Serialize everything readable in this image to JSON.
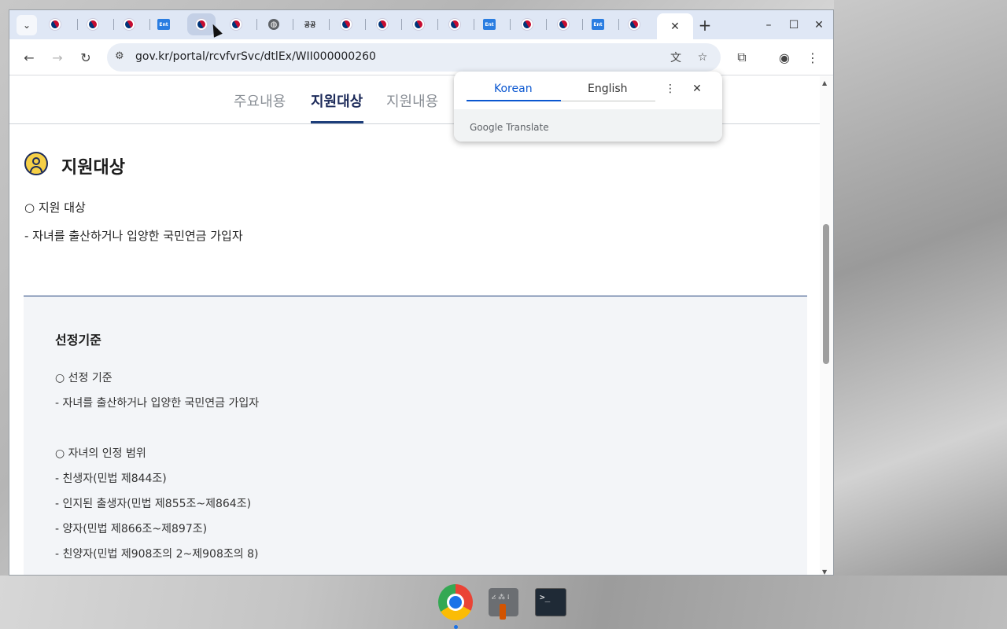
{
  "browser": {
    "tab_search_icon": "chevron-down-icon",
    "active_tab_close": "✕",
    "new_tab": "+",
    "window_controls": {
      "minimize": "–",
      "maximize": "☐",
      "close": "✕"
    },
    "url": "gov.kr/portal/rcvfvrSvc/dtlEx/WII000000260",
    "tab_text_favicon": "공공"
  },
  "page": {
    "subtabs": [
      "주요내용",
      "지원대상",
      "지원내용"
    ],
    "active_subtab": "지원대상",
    "section_title": "지원대상",
    "section_lines": [
      "○ 지원 대상",
      "- 자녀를 출산하거나 입양한 국민연금 가입자"
    ],
    "box": {
      "title": "선정기준",
      "lines": [
        "○ 선정 기준",
        "- 자녀를 출산하거나 입양한 국민연금 가입자",
        "○ 자녀의 인정 범위",
        "- 친생자(민법 제844조)",
        "- 인지된 출생자(민법 제855조~제864조)",
        "- 양자(민법 제866조~제897조)",
        "- 친양자(민법 제908조의 2~제908조의 8)"
      ]
    }
  },
  "translate_popup": {
    "tabs": [
      "Korean",
      "English"
    ],
    "active": "Korean",
    "brand": "Google Translate"
  },
  "taskbar": {
    "tool_label": "ሪ ⁂ ᎒"
  },
  "colors": {
    "brand_navy": "#1d2b5a",
    "accent_blue": "#0b57d0",
    "tab_strip": "#dfe7f5"
  }
}
